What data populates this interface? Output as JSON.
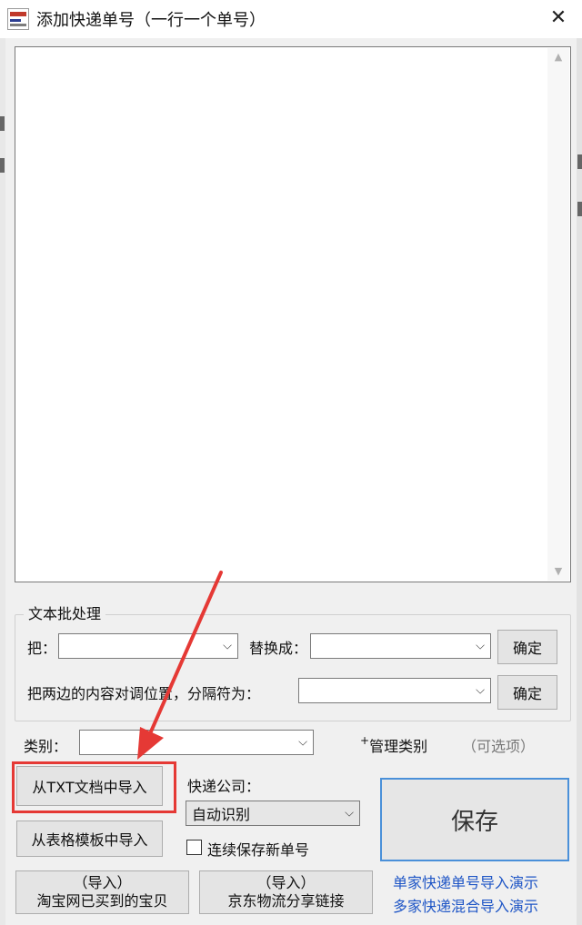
{
  "window": {
    "title": "添加快递单号（一行一个单号）",
    "close_glyph": "✕"
  },
  "textarea": {
    "value": ""
  },
  "batch": {
    "legend": "文本批处理",
    "from_label": "把：",
    "from_value": "",
    "replace_label": "替换成：",
    "replace_value": "",
    "confirm1": "确定",
    "swap_label": "把两边的内容对调位置，分隔符为：",
    "swap_value": "",
    "confirm2": "确定"
  },
  "category": {
    "label": "类别：",
    "value": "",
    "manage": "管理类别",
    "optional": "（可选项）"
  },
  "import_txt": "从TXT文档中导入",
  "import_table": "从表格模板中导入",
  "courier": {
    "label": "快递公司：",
    "value": "自动识别"
  },
  "continuous_save": {
    "label": "连续保存新单号",
    "checked": false
  },
  "save": "保存",
  "taobao": {
    "line1": "（导入）",
    "line2": "淘宝网已买到的宝贝"
  },
  "jd": {
    "line1": "（导入）",
    "line2": "京东物流分享链接"
  },
  "links": {
    "single_demo": "单家快递单号导入演示",
    "multi_demo": "多家快递混合导入演示"
  },
  "icons": {
    "app": "app-icon",
    "close": "close-icon",
    "dropdown": "chevron-down-icon",
    "scroll_up": "chevron-up-icon",
    "scroll_down": "chevron-down-icon"
  },
  "colors": {
    "highlight": "#e53935",
    "link": "#1f56c6",
    "save_border": "#4a90d9"
  }
}
